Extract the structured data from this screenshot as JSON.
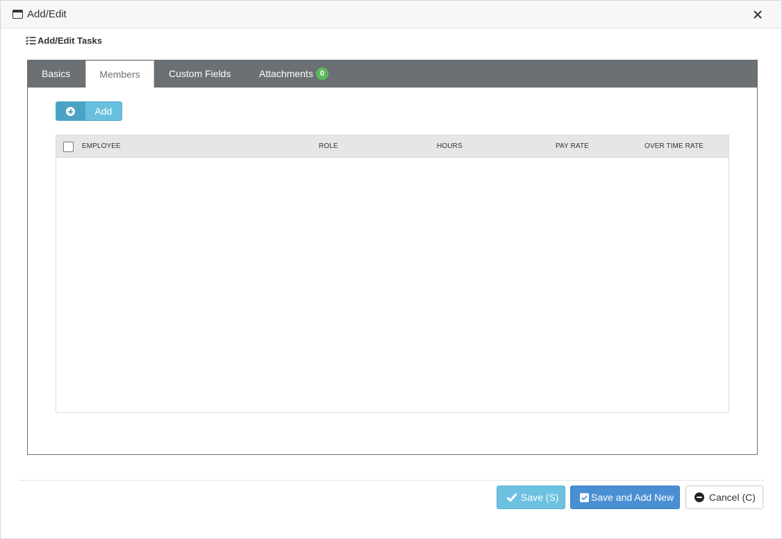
{
  "window": {
    "title": "Add/Edit",
    "close_symbol": "✕"
  },
  "section": {
    "title": "Add/Edit Tasks"
  },
  "tabs": [
    {
      "label": "Basics",
      "active": false
    },
    {
      "label": "Members",
      "active": true
    },
    {
      "label": "Custom Fields",
      "active": false
    },
    {
      "label": "Attachments",
      "active": false,
      "badge": "0"
    }
  ],
  "members": {
    "add_label": "Add",
    "columns": [
      "EMPLOYEE",
      "ROLE",
      "HOURS",
      "PAY RATE",
      "OVER TIME RATE"
    ],
    "rows": []
  },
  "footer": {
    "save_label": "Save (S)",
    "save_add_label": "Save and Add New",
    "cancel_label": "Cancel (C)"
  },
  "colors": {
    "tabbar": "#6b7074",
    "badge": "#5cb85c",
    "save": "#6dc1e0",
    "save_add": "#4a8fd3",
    "add_button": "#68c0de"
  },
  "icons": {
    "window": "window-icon",
    "close": "close-icon",
    "tasks": "tasks-list-icon",
    "add": "plus-circle-icon",
    "save": "check-icon",
    "save_add": "check-square-icon",
    "cancel": "minus-circle-icon"
  }
}
